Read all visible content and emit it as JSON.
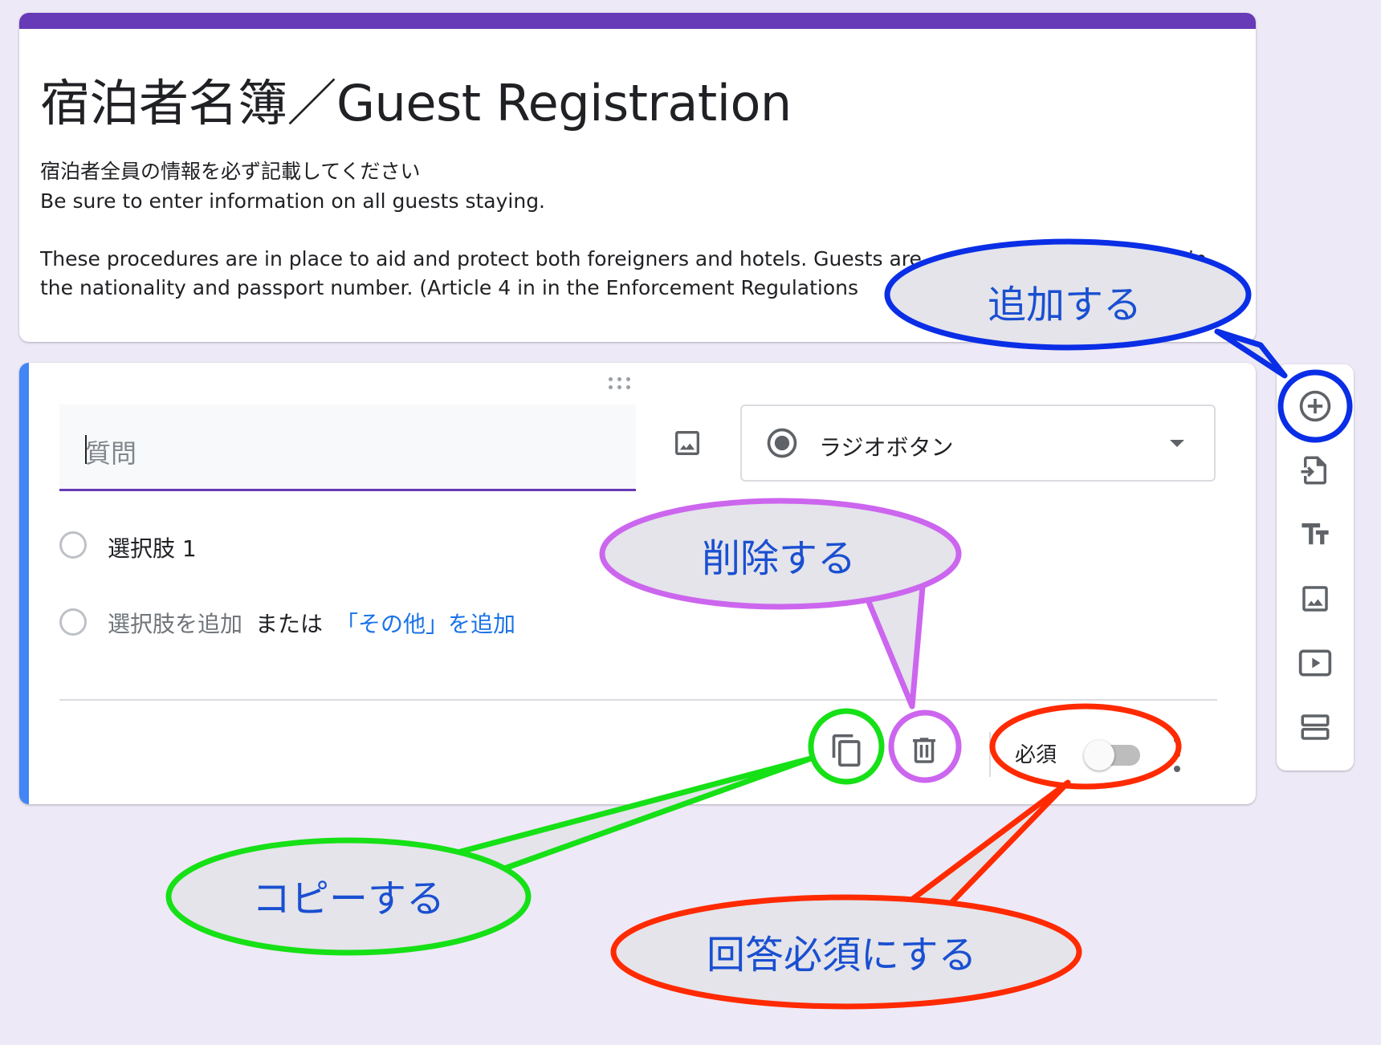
{
  "form": {
    "accent_color": "#673ab7",
    "title": "宿泊者名簿／Guest Registration",
    "description": {
      "line1": "宿泊者全員の情報を必ず記載してください",
      "line2": "Be sure to enter information on all guests staying.",
      "line3": "These procedures are in place to aid and protect both foreigners and hotels. Guests are",
      "line3_tail": "in",
      "line4": "the nationality and passport number. (Article 4 in in the Enforcement Regulations"
    }
  },
  "question": {
    "placeholder": "質問",
    "type_label": "ラジオボタン",
    "type_icon": "radio-button-checked-icon",
    "options": [
      {
        "label": "選択肢 1"
      }
    ],
    "add_option": {
      "label": "選択肢を追加",
      "or": "または",
      "add_other": "「その他」を追加"
    },
    "footer": {
      "required_label": "必須",
      "required": false
    }
  },
  "side_toolbar": {
    "items": [
      "add-circle-icon",
      "import-file-icon",
      "title-text-icon",
      "image-icon",
      "video-icon",
      "section-icon"
    ]
  },
  "annotations": {
    "add": "追加する",
    "delete": "削除する",
    "copy": "コピーする",
    "required": "回答必須にする",
    "colors": {
      "add": "#0a2ee6",
      "delete": "#cc66ee",
      "copy": "#16e016",
      "required": "#ff2a00"
    }
  }
}
